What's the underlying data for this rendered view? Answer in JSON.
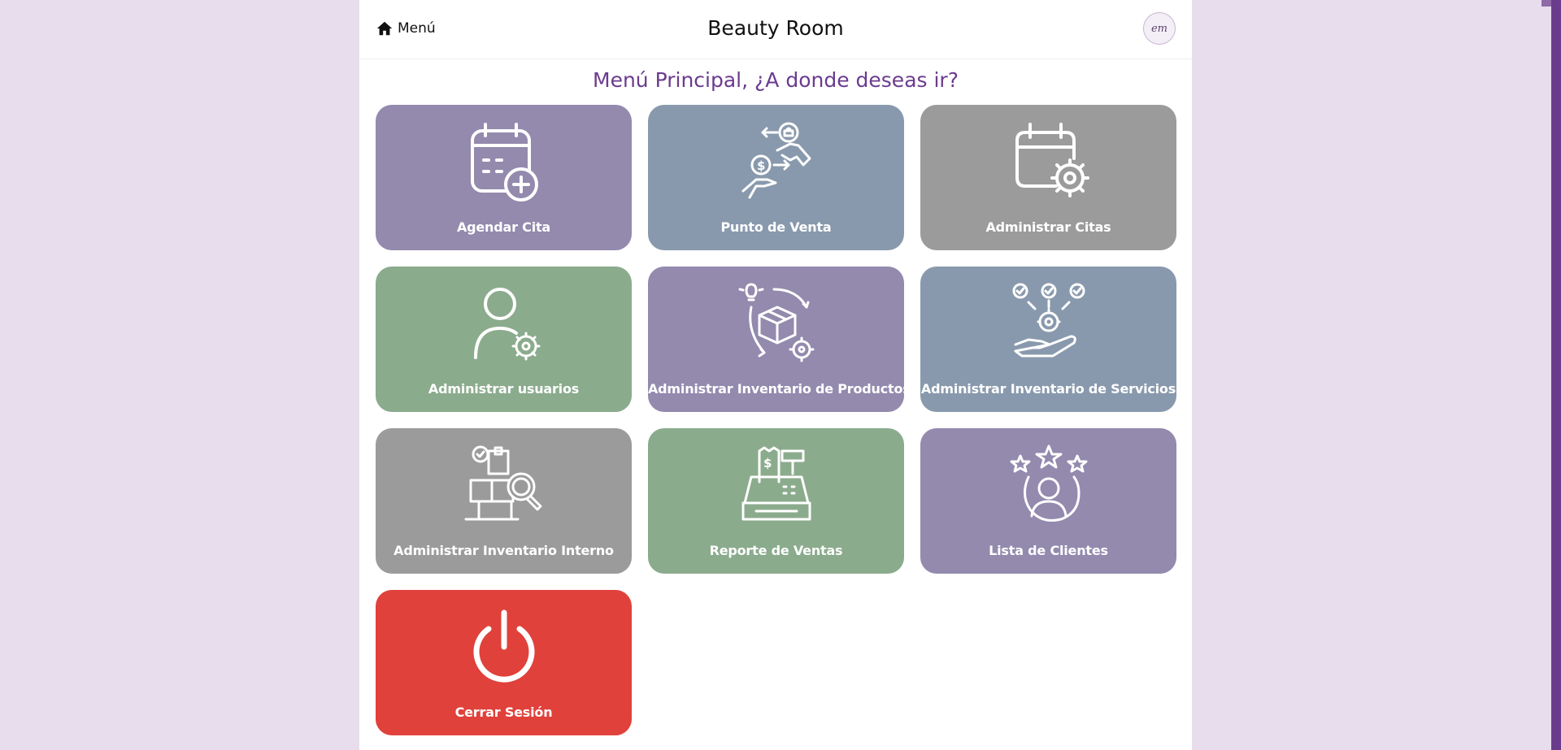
{
  "header": {
    "menu_label": "Menú",
    "brand": "Beauty Room",
    "avatar_text": "em"
  },
  "main": {
    "heading": "Menú Principal, ¿A donde deseas ir?",
    "tiles": [
      {
        "label": "Agendar Cita",
        "icon": "calendar-plus-icon",
        "color": "#938aae"
      },
      {
        "label": "Punto de Venta",
        "icon": "exchange-hands-icon",
        "color": "#8999ad"
      },
      {
        "label": "Administrar Citas",
        "icon": "calendar-gear-icon",
        "color": "#9b9b9b"
      },
      {
        "label": "Administrar usuarios",
        "icon": "user-gear-icon",
        "color": "#8bab8d"
      },
      {
        "label": "Administrar Inventario de Productos",
        "icon": "box-cycle-icon",
        "color": "#938aae"
      },
      {
        "label": "Administrar Inventario de Servicios",
        "icon": "hand-gear-checks-icon",
        "color": "#8999ad"
      },
      {
        "label": "Administrar Inventario Interno",
        "icon": "boxes-search-icon",
        "color": "#9b9b9b"
      },
      {
        "label": "Reporte de Ventas",
        "icon": "cash-register-icon",
        "color": "#8bab8d"
      },
      {
        "label": "Lista de Clientes",
        "icon": "client-stars-icon",
        "color": "#938aae"
      },
      {
        "label": "Cerrar Sesión",
        "icon": "power-icon",
        "color": "#e0413b"
      }
    ]
  },
  "colors": {
    "page_background": "#e8dded",
    "heading": "#6b3b8f",
    "scroll_accent": "#6a3d8c"
  }
}
